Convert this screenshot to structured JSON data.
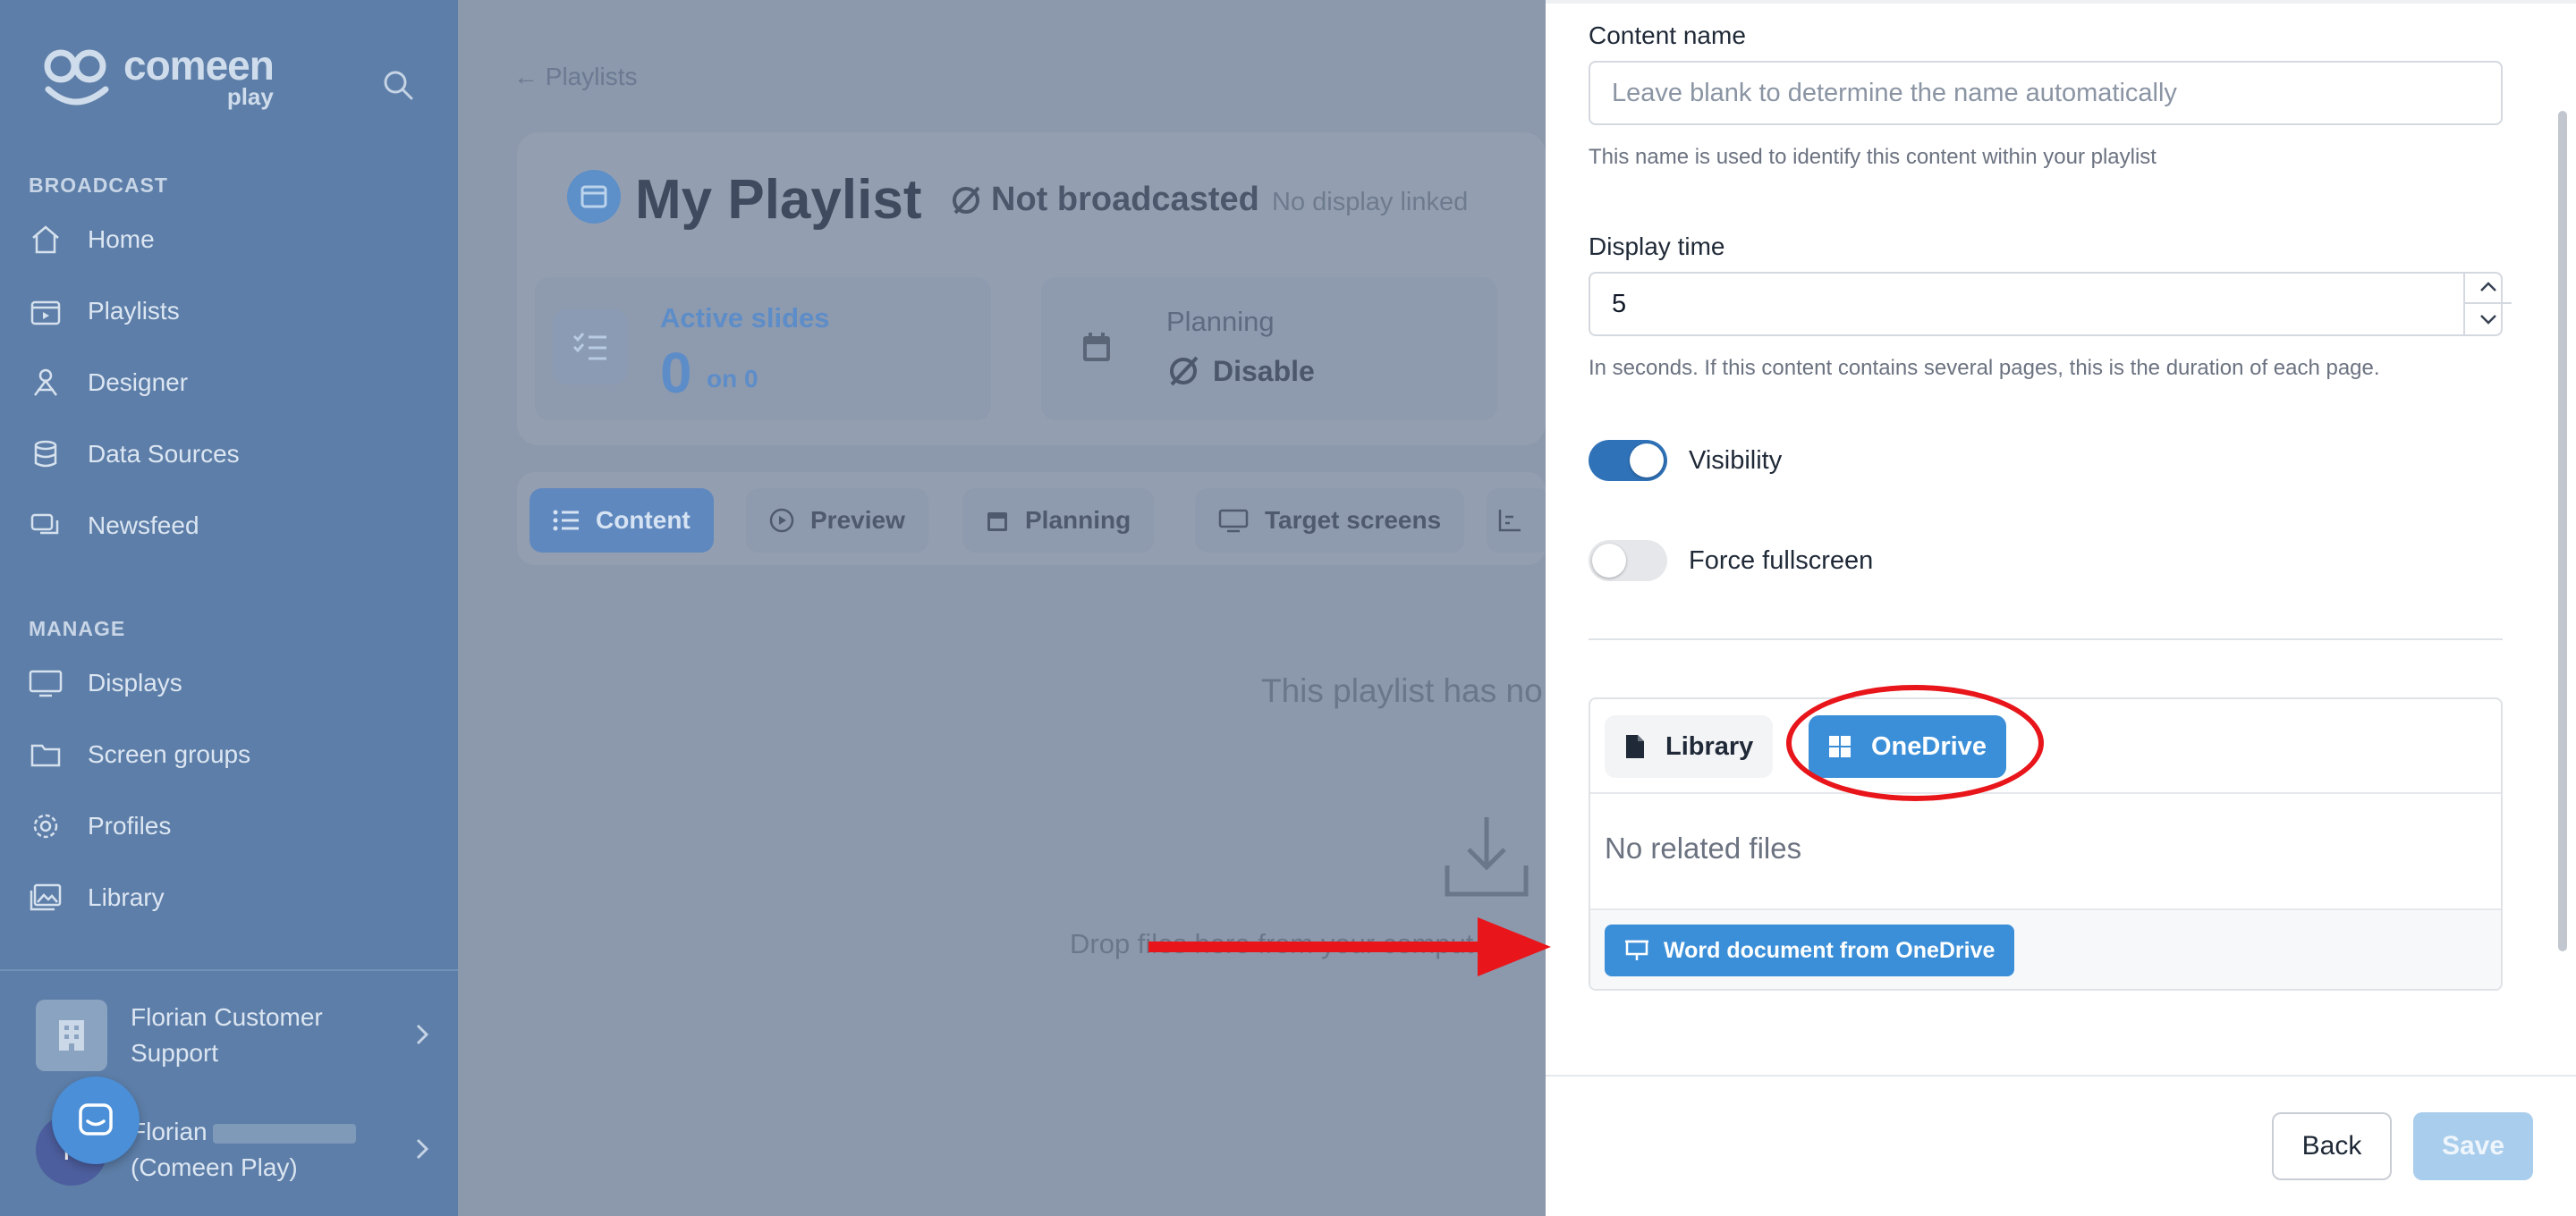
{
  "brand": {
    "logo_main": "comeen",
    "logo_sub": "play"
  },
  "sidebar": {
    "broadcast_label": "BROADCAST",
    "broadcast_items": [
      {
        "label": "Home",
        "icon": "home-icon"
      },
      {
        "label": "Playlists",
        "icon": "playlist-icon"
      },
      {
        "label": "Designer",
        "icon": "designer-icon"
      },
      {
        "label": "Data Sources",
        "icon": "database-icon"
      },
      {
        "label": "Newsfeed",
        "icon": "newsfeed-icon"
      }
    ],
    "manage_label": "MANAGE",
    "manage_items": [
      {
        "label": "Displays",
        "icon": "monitor-icon"
      },
      {
        "label": "Screen groups",
        "icon": "folder-icon"
      },
      {
        "label": "Profiles",
        "icon": "gear-icon"
      },
      {
        "label": "Library",
        "icon": "images-icon"
      }
    ],
    "organization": "Florian Customer Support",
    "user_first": "Florian",
    "user_second": "(Comeen Play)",
    "user_initial": "F"
  },
  "main": {
    "breadcrumb": "Playlists",
    "playlist_title": "My Playlist",
    "status": "Not broadcasted",
    "no_display": "No display linked",
    "stats": {
      "active_label": "Active slides",
      "active_value": "0",
      "active_total": "on 0",
      "planning_label": "Planning",
      "planning_value": "Disable"
    },
    "tabs": [
      {
        "label": "Content",
        "icon": "list-icon"
      },
      {
        "label": "Preview",
        "icon": "play-icon"
      },
      {
        "label": "Planning",
        "icon": "calendar-icon"
      },
      {
        "label": "Target screens",
        "icon": "monitor-icon"
      }
    ],
    "empty_message": "This playlist has no",
    "drop_message": "Drop files here from your comput"
  },
  "panel": {
    "content_name_label": "Content name",
    "content_name_placeholder": "Leave blank to determine the name automatically",
    "content_name_help": "This name is used to identify this content within your playlist",
    "display_time_label": "Display time",
    "display_time_value": "5",
    "display_time_help": "In seconds. If this content contains several pages, this is the duration of each page.",
    "visibility_label": "Visibility",
    "visibility_on": true,
    "fullscreen_label": "Force fullscreen",
    "fullscreen_on": false,
    "file_tabs": [
      {
        "label": "Library",
        "icon": "file-icon",
        "active": false
      },
      {
        "label": "OneDrive",
        "icon": "windows-icon",
        "active": true
      }
    ],
    "files_empty": "No related files",
    "word_button": "Word document from OneDrive",
    "back_label": "Back",
    "save_label": "Save"
  },
  "colors": {
    "accent": "#3b8fd8",
    "toggle_on": "#2f72b8",
    "annotation_red": "#e8151b",
    "overlay": "#8c98ab"
  }
}
